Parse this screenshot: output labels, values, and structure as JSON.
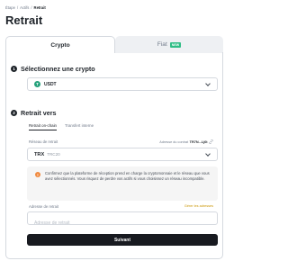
{
  "breadcrumb": {
    "items": [
      "Étape",
      "Actifs"
    ],
    "current": "Retrait"
  },
  "page_title": "Retrait",
  "tabs": {
    "crypto": "Crypto",
    "fiat": "Fiat",
    "fiat_badge": "NEW"
  },
  "step1": {
    "number": "1",
    "title": "Sélectionnez une crypto"
  },
  "coin": {
    "icon_glyph": "T",
    "symbol": "USDT",
    "icon": "tether-icon",
    "color": "#26a17b"
  },
  "step2": {
    "number": "2",
    "title": "Retrait vers"
  },
  "subtabs": [
    "Retrait on-chain",
    "Transfert interne"
  ],
  "network": {
    "label": "Réseau de retrait",
    "address_label": "Adresse du contrat",
    "address_value": "TR7N...Lj6t",
    "code": "TRX",
    "name": "TRC20"
  },
  "warning": {
    "icon_glyph": "!",
    "text": "Confirmez que la plateforme de réception prend en charge la cryptomonnaie et le réseau que vous avez sélectionnés. Vous risquez de perdre vos actifs si vous choisissez un réseau incompatible."
  },
  "address_field": {
    "label": "Adresse de retrait",
    "link": "Gérer les adresses",
    "placeholder": "Adresse de retrait",
    "value": ""
  },
  "submit_label": "Suivant",
  "colors": {
    "accent": "#f0b90b",
    "warning": "#f0893e",
    "tether": "#26a17b"
  }
}
